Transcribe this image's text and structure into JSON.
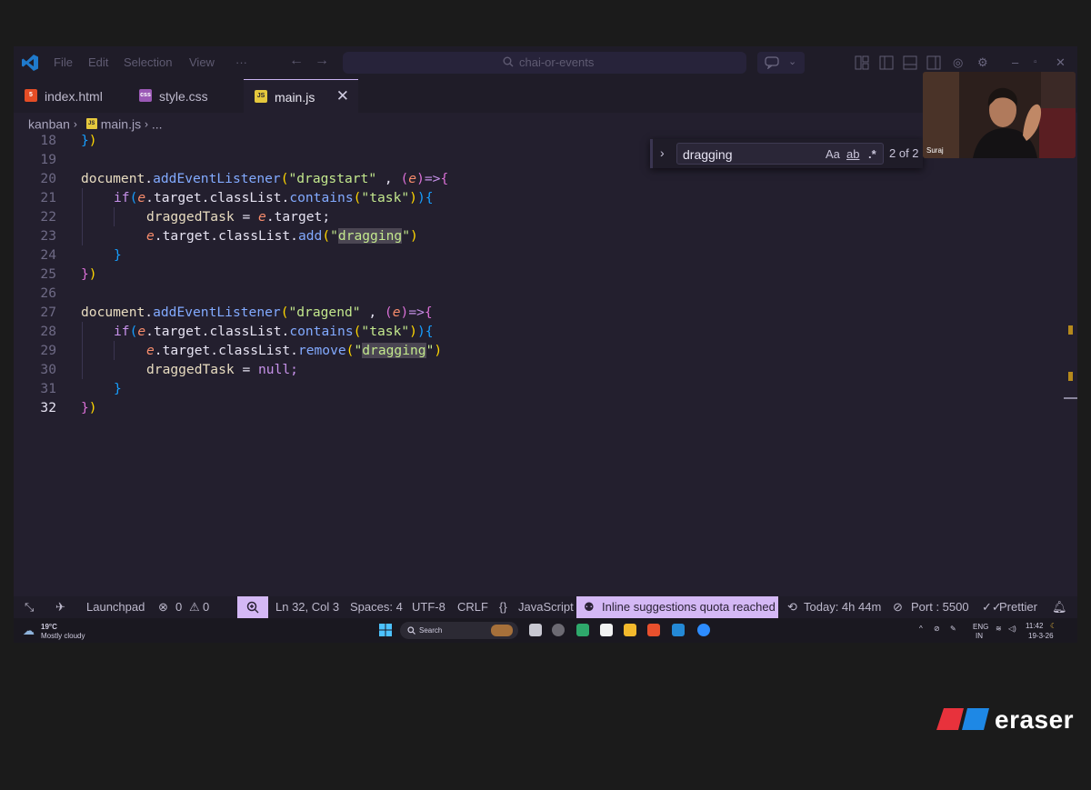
{
  "menu": [
    "File",
    "Edit",
    "Selection",
    "View",
    "···"
  ],
  "command_center": "chai-or-events",
  "tabs": [
    {
      "label": "index.html",
      "icon": "html5-icon"
    },
    {
      "label": "style.css",
      "icon": "css-icon"
    },
    {
      "label": "main.js",
      "icon": "js-icon",
      "active": true
    }
  ],
  "breadcrumb": {
    "folder": "kanban",
    "file": "main.js",
    "more": "..."
  },
  "code_lines": [
    {
      "n": "18"
    },
    {
      "n": "19"
    },
    {
      "n": "20"
    },
    {
      "n": "21"
    },
    {
      "n": "22"
    },
    {
      "n": "23"
    },
    {
      "n": "24"
    },
    {
      "n": "25"
    },
    {
      "n": "26"
    },
    {
      "n": "27"
    },
    {
      "n": "28"
    },
    {
      "n": "29"
    },
    {
      "n": "30"
    },
    {
      "n": "31"
    },
    {
      "n": "32"
    }
  ],
  "tokens": {
    "document": "document",
    "addEventListener": "addEventListener",
    "dragstart": "\"dragstart\"",
    "dragend": "\"dragend\"",
    "e": "e",
    "arrow": "=>",
    "if": "if",
    "target_classList": ".target.classList.",
    "contains": "contains",
    "task": "\"task\"",
    "draggedTask": "draggedTask",
    "eq": " = ",
    "target": ".target;",
    "add": "add",
    "remove": "remove",
    "dragging_q": "\"",
    "dragging": "dragging",
    "null": "null;",
    "comma": " , "
  },
  "find": {
    "query": "dragging",
    "case": "Aa",
    "word": "ab",
    "regex": ".*",
    "count": "2 of 2"
  },
  "webcam": {
    "name": "Suraj"
  },
  "statusbar": {
    "launchpad": "Launchpad",
    "errors": "0",
    "warnings": "0",
    "position": "Ln 32, Col 3",
    "spaces": "Spaces: 4",
    "encoding": "UTF-8",
    "eol": "CRLF",
    "language": "JavaScript",
    "quota": "Inline suggestions quota reached",
    "today": "Today: 4h 44m",
    "port": "Port : 5500",
    "prettier": "Prettier"
  },
  "taskbar": {
    "temp": "19°C",
    "weather": "Mostly cloudy",
    "search": "Search",
    "lang1": "ENG",
    "lang2": "IN",
    "time": "11:42",
    "date": "19-3-26"
  },
  "brand": "eraser",
  "colors": {
    "accent": "#d4b8f5",
    "editor_bg": "#231f2e",
    "eraser_red": "#e8323c",
    "eraser_blue": "#1e88e5"
  }
}
